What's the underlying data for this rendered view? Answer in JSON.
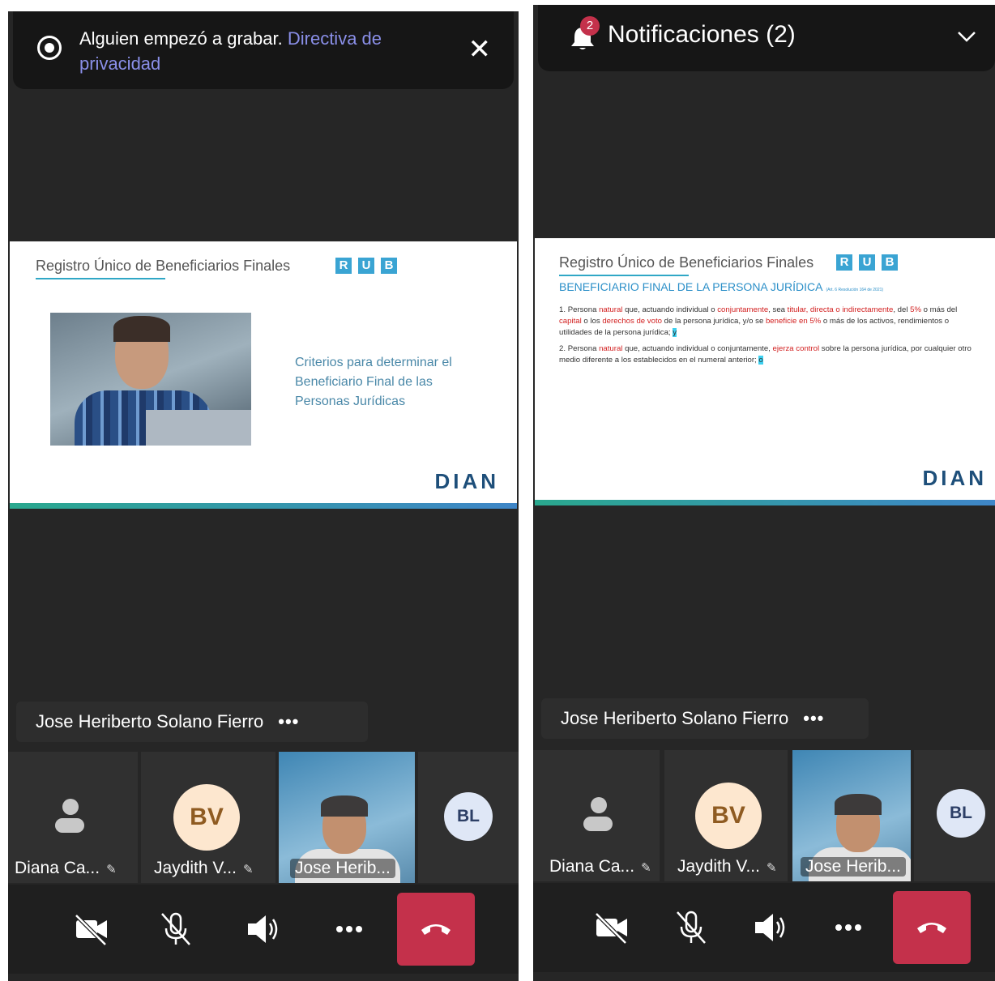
{
  "left_screen": {
    "banner": {
      "text": "Alguien empezó a grabar.",
      "link": "Directiva de privacidad",
      "close": "✕"
    },
    "slide": {
      "title": "Registro Único de Beneficiarios Finales",
      "rub": [
        "R",
        "U",
        "B"
      ],
      "caption": "Criterios para determinar el Beneficiario Final de las Personas Jurídicas",
      "logo": "DIAN"
    },
    "speaker": {
      "name": "Jose Heriberto Solano Fierro",
      "more": "•••"
    },
    "participants": [
      {
        "name": "Diana Ca...",
        "muted": true
      },
      {
        "name": "Jaydith V...",
        "initials": "BV",
        "muted": true
      },
      {
        "name": "Jose Herib...",
        "video": true
      },
      {
        "initials": "BL"
      }
    ]
  },
  "right_screen": {
    "notifications": {
      "title": "Notificaciones (2)",
      "badge": "2"
    },
    "slide": {
      "title": "Registro Único de Beneficiarios Finales",
      "rub": [
        "R",
        "U",
        "B"
      ],
      "subtitle": "BENEFICIARIO FINAL DE LA PERSONA JURÍDICA",
      "reference": "(Art. 6 Resolución 164 de 2021)",
      "point1": {
        "num": "1.",
        "t1": "Persona ",
        "r1": "natural",
        "t2": " que, actuando individual o ",
        "r2": "conjuntamente",
        "t3": ", sea ",
        "r3": "titular, directa o indirectamente",
        "t4": ", del ",
        "r4": "5%",
        "t5": " o más del ",
        "r5": "capital",
        "t6": " o los ",
        "r6": "derechos de voto",
        "t7": " de la persona jurídica, y/o se ",
        "r7": "beneficie en 5%",
        "t8": " o más de los activos, rendimientos o utilidades de la persona jurídica; ",
        "hl": "y"
      },
      "point2": {
        "num": "2.",
        "t1": "Persona ",
        "r1": "natural",
        "t2": " que, actuando individual o conjuntamente, ",
        "r2": "ejerza control",
        "t3": " sobre la persona jurídica, por cualquier otro medio diferente a los establecidos en el numeral anterior; ",
        "hl": "o"
      },
      "logo": "DIAN"
    },
    "speaker": {
      "name": "Jose Heriberto Solano Fierro",
      "more": "•••"
    },
    "participants": [
      {
        "name": "Diana Ca...",
        "muted": true
      },
      {
        "name": "Jaydith V...",
        "initials": "BV",
        "muted": true
      },
      {
        "name": "Jose Herib...",
        "video": true
      },
      {
        "initials": "BL"
      }
    ]
  },
  "icons": {
    "camera_off": "camera-off-icon",
    "mic_off": "mic-off-icon",
    "speaker": "speaker-icon",
    "more": "more-icon",
    "hangup": "hangup-icon",
    "mute_mark": "✎"
  },
  "colors": {
    "background": "#262626",
    "hangup": "#c4314b",
    "link": "#8a8fe8",
    "rub": "#3aa4d3",
    "slide_accent": "#2b8fc8"
  }
}
